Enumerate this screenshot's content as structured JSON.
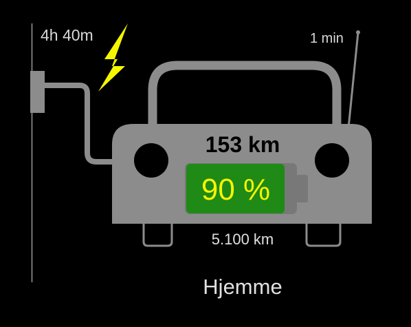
{
  "status": {
    "charge_time": "4h 40m",
    "update_age": "1 min",
    "range": "153 km",
    "battery_percent": "90 %",
    "odometer": "5.100 km",
    "location": "Hjemme"
  },
  "battery": {
    "level_percent": 90,
    "fill_color": "#1f8a16",
    "text_color": "#f5f500"
  },
  "colors": {
    "background": "#000000",
    "car_body": "#8c8c8c",
    "bolt": "#f5f500"
  },
  "icons": [
    "charging-bolt-icon",
    "antenna-icon",
    "charger-plug-icon",
    "car-icon"
  ]
}
